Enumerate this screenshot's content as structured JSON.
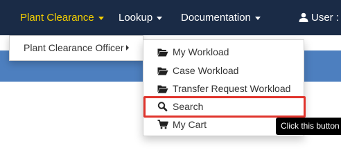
{
  "navbar": {
    "items": [
      {
        "label": "Plant Clearance",
        "active": true
      },
      {
        "label": "Lookup"
      },
      {
        "label": "Documentation"
      }
    ],
    "user_label": "User :"
  },
  "submenu": {
    "item_label": "Plant Clearance Officer"
  },
  "dropdown": {
    "items": [
      {
        "label": "My Workload",
        "icon": "folder-open-icon"
      },
      {
        "label": "Case Workload",
        "icon": "folder-open-icon"
      },
      {
        "label": "Transfer Request Workload",
        "icon": "folder-open-icon"
      },
      {
        "label": "Search",
        "icon": "search-icon",
        "highlighted": true
      },
      {
        "label": "My Cart",
        "icon": "cart-icon"
      }
    ]
  },
  "tooltip": {
    "text": "Click this button"
  },
  "colors": {
    "navbar_bg": "#1a2b46",
    "active_nav": "#f5d000",
    "band": "#4d7fbf",
    "highlight": "#e0342c"
  }
}
